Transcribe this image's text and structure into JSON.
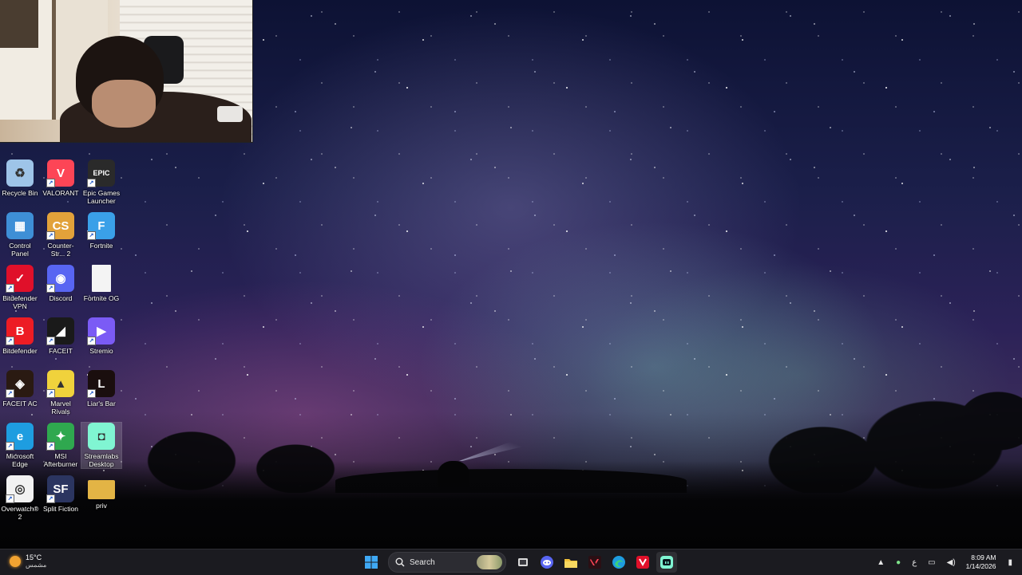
{
  "desktop": {
    "icons": [
      {
        "label": "Recycle Bin",
        "icon": "recycle-bin-icon",
        "shortcut": false,
        "color": "#9ec4e8"
      },
      {
        "label": "VALORANT",
        "icon": "valorant-icon",
        "shortcut": true,
        "color": "#fd4556"
      },
      {
        "label": "Epic Games Launcher",
        "icon": "epic-games-icon",
        "shortcut": true,
        "color": "#2a2a2a"
      },
      {
        "label": "Control Panel",
        "icon": "control-panel-icon",
        "shortcut": false,
        "color": "#3e8fd6"
      },
      {
        "label": "Counter-Str... 2",
        "icon": "counter-strike-icon",
        "shortcut": true,
        "color": "#e2a23a"
      },
      {
        "label": "Fortnite",
        "icon": "fortnite-icon",
        "shortcut": true,
        "color": "#3aa0e8"
      },
      {
        "label": "Bitdefender VPN",
        "icon": "bitdefender-vpn-icon",
        "shortcut": true,
        "color": "#e0102a"
      },
      {
        "label": "Discord",
        "icon": "discord-icon",
        "shortcut": true,
        "color": "#5865f2"
      },
      {
        "label": "Fortnite OG",
        "icon": "file-icon",
        "shortcut": false,
        "color": "#f4f4f4"
      },
      {
        "label": "Bitdefender",
        "icon": "bitdefender-icon",
        "shortcut": true,
        "color": "#ed1c24"
      },
      {
        "label": "FACEIT",
        "icon": "faceit-icon",
        "shortcut": true,
        "color": "#1a1a1a"
      },
      {
        "label": "Stremio",
        "icon": "stremio-icon",
        "shortcut": true,
        "color": "#7b5bf5"
      },
      {
        "label": "FACEIT AC",
        "icon": "faceit-ac-icon",
        "shortcut": true,
        "color": "#2a1a12"
      },
      {
        "label": "Marvel Rivals",
        "icon": "marvel-rivals-icon",
        "shortcut": true,
        "color": "#f0d23c"
      },
      {
        "label": "Liar's Bar",
        "icon": "liars-bar-icon",
        "shortcut": true,
        "color": "#1a0e0e"
      },
      {
        "label": "Microsoft Edge",
        "icon": "edge-icon",
        "shortcut": true,
        "color": "#1e9de0"
      },
      {
        "label": "MSI Afterburner",
        "icon": "msi-afterburner-icon",
        "shortcut": true,
        "color": "#2fa84f"
      },
      {
        "label": "Streamlabs Desktop",
        "icon": "streamlabs-icon",
        "shortcut": false,
        "color": "#80f5d2"
      },
      {
        "label": "Overwatch® 2",
        "icon": "overwatch-icon",
        "shortcut": true,
        "color": "#f2f2f2"
      },
      {
        "label": "Split Fiction",
        "icon": "split-fiction-icon",
        "shortcut": true,
        "color": "#2b3560"
      },
      {
        "label": "priv",
        "icon": "folder-icon",
        "shortcut": false,
        "color": "#e3b445"
      }
    ],
    "selected_icon": "Streamlabs Desktop"
  },
  "taskbar": {
    "weather": {
      "temp": "15°C",
      "condition": "مشمس"
    },
    "search_label": "Search",
    "apps": [
      {
        "name": "start-button",
        "icon": "windows-icon"
      },
      {
        "name": "task-view-button",
        "icon": "task-view-icon"
      },
      {
        "name": "taskbar-discord",
        "icon": "discord-icon"
      },
      {
        "name": "taskbar-file-explorer",
        "icon": "folder-icon"
      },
      {
        "name": "taskbar-valorant",
        "icon": "valorant-icon"
      },
      {
        "name": "taskbar-edge",
        "icon": "edge-icon"
      },
      {
        "name": "taskbar-bitdefender",
        "icon": "bitdefender-icon"
      },
      {
        "name": "taskbar-streamlabs",
        "icon": "streamlabs-icon"
      }
    ],
    "tray": {
      "input_lang": "ع",
      "time": "8:09 AM",
      "date": "1/14/2026"
    }
  }
}
